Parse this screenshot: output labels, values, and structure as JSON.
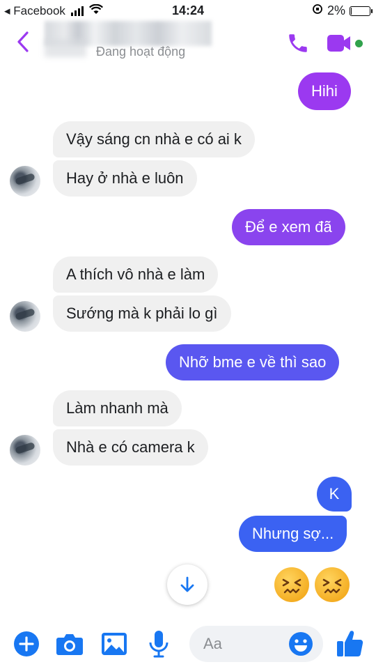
{
  "status_bar": {
    "carrier": "◂ Facebook",
    "time": "14:24",
    "battery_percent_label": "2%",
    "battery_level": 0.02
  },
  "header": {
    "status": "Đang hoạt động"
  },
  "colors": {
    "accent": "#9b39f0",
    "outgoing_purple": "#8a44ee",
    "outgoing_blue": "#3b62f2",
    "incoming_bg": "#f0f0f0",
    "icon_blue": "#1877f2",
    "online_green": "#31a24c"
  },
  "messages": [
    {
      "side": "outgoing",
      "text": "Hihi"
    },
    {
      "side": "incoming",
      "text": "Vậy sáng cn nhà e có ai k"
    },
    {
      "side": "incoming",
      "text": "Hay ở nhà e luôn"
    },
    {
      "side": "outgoing",
      "text": "Để e xem đã"
    },
    {
      "side": "incoming",
      "text": "A thích vô nhà e làm"
    },
    {
      "side": "incoming",
      "text": "Sướng mà k phải lo gì"
    },
    {
      "side": "outgoing",
      "text": "Nhỡ bme e về thì sao"
    },
    {
      "side": "incoming",
      "text": "Làm nhanh mà"
    },
    {
      "side": "incoming",
      "text": "Nhà e có camera k"
    },
    {
      "side": "outgoing",
      "text": "K"
    },
    {
      "side": "outgoing",
      "text": "Nhưng sợ..."
    }
  ],
  "reactions": [
    "confounded-face-emoji",
    "confounded-face-emoji"
  ],
  "composer": {
    "placeholder": "Aa"
  },
  "icons": [
    "back-chevron-icon",
    "phone-icon",
    "video-camera-icon",
    "plus-icon",
    "camera-icon",
    "gallery-icon",
    "microphone-icon",
    "smiley-icon",
    "thumbs-up-icon",
    "arrow-down-icon"
  ]
}
